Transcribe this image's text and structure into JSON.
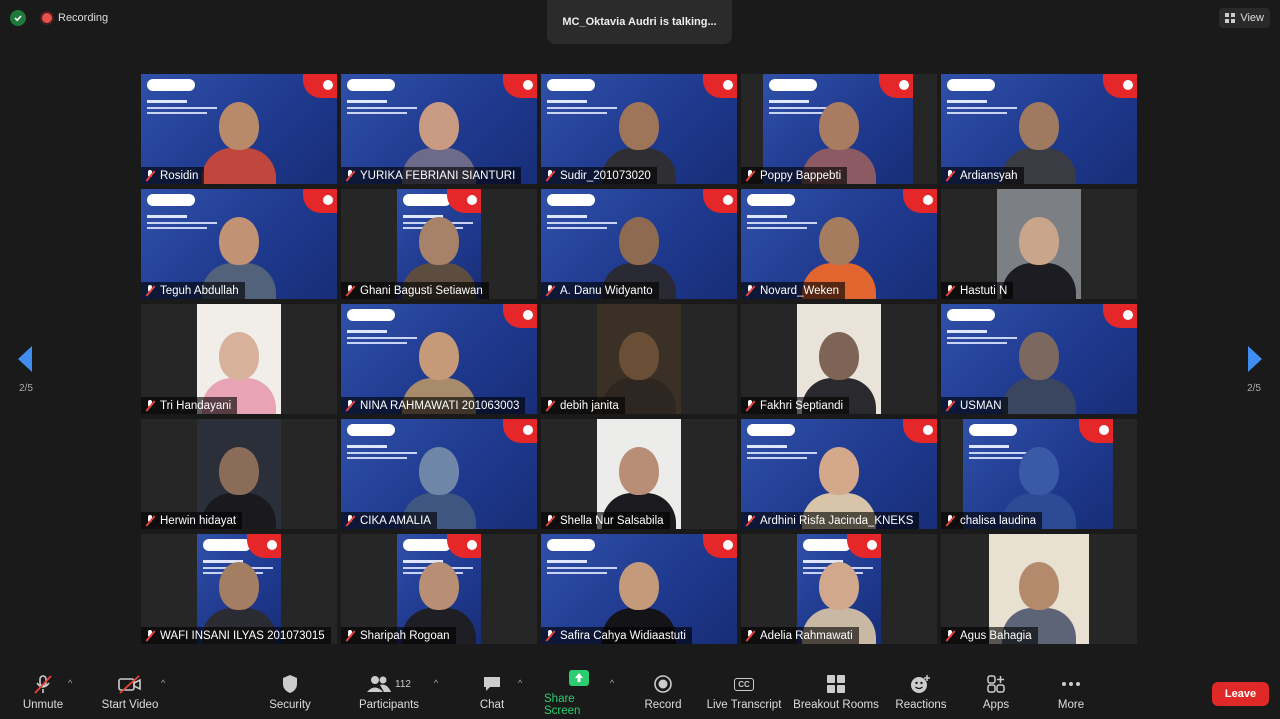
{
  "top": {
    "recording_label": "Recording",
    "talking_label": "MC_Oktavia Audri is talking...",
    "view_label": "View"
  },
  "pagination": {
    "left": "2/5",
    "right": "2/5"
  },
  "participants": [
    {
      "name": "Rosidin",
      "bg": "slide-full",
      "skin": "#b98a6a",
      "shirt": "#c0473d"
    },
    {
      "name": "YURIKA FEBRIANI SIANTURI",
      "bg": "slide-full",
      "skin": "#c99b82",
      "shirt": "#6d6a8a"
    },
    {
      "name": "Sudir_201073020",
      "bg": "slide-full",
      "skin": "#9e7558",
      "shirt": "#2f2f33"
    },
    {
      "name": "Poppy Bappebti",
      "bg": "slide-mid",
      "skin": "#a97c62",
      "shirt": "#8c5a62"
    },
    {
      "name": "Ardiansyah",
      "bg": "slide-full",
      "skin": "#a07a60",
      "shirt": "#3b3b44"
    },
    {
      "name": "Teguh Abdullah",
      "bg": "slide-full",
      "skin": "#c29274",
      "shirt": "#51627a"
    },
    {
      "name": "Ghani Bagusti Setiawan",
      "bg": "slide-narrow",
      "skin": "#a88268",
      "shirt": "#5d4c40"
    },
    {
      "name": "A. Danu Widyanto",
      "bg": "slide-full",
      "skin": "#8e6a50",
      "shirt": "#2a2a34"
    },
    {
      "name": "Novard_Weken",
      "bg": "slide-full",
      "skin": "#a57c5e",
      "shirt": "#e0652e"
    },
    {
      "name": "Hastuti N",
      "bg": "cam-narrow",
      "skin": "#c9a58b",
      "shirt": "#1c1c22",
      "cambg": "#7c7f84"
    },
    {
      "name": "Tri Handayani",
      "bg": "cam-narrow",
      "skin": "#d8b19a",
      "shirt": "#e8a3b4",
      "cambg": "#f1eee9"
    },
    {
      "name": "NINA RAHMAWATI 201063003",
      "bg": "slide-full",
      "skin": "#c69a78",
      "shirt": "#a78b6a"
    },
    {
      "name": "debih janita",
      "bg": "cam-narrow",
      "skin": "#6a4e36",
      "shirt": "#2e2620",
      "cambg": "#3a3026"
    },
    {
      "name": "Fakhri Septiandi",
      "bg": "cam-narrow",
      "skin": "#7e6454",
      "shirt": "#2a2a2e",
      "cambg": "#e9e3d9"
    },
    {
      "name": "USMAN",
      "bg": "slide-full",
      "skin": "#7d6860",
      "shirt": "#3a4660"
    },
    {
      "name": "Herwin hidayat",
      "bg": "cam-narrow",
      "skin": "#8a6c58",
      "shirt": "#1a1a1e",
      "cambg": "#2b2f3a"
    },
    {
      "name": "CIKA AMALIA",
      "bg": "slide-full",
      "skin": "#6f86a8",
      "shirt": "#3f5680"
    },
    {
      "name": "Shella Nur Salsabila",
      "bg": "cam-narrow",
      "skin": "#b98e76",
      "shirt": "#1b1b1f",
      "cambg": "#ececea"
    },
    {
      "name": "Ardhini Risfa Jacinda_KNEKS",
      "bg": "slide-full",
      "skin": "#d4a88a",
      "shirt": "#d8c4a8"
    },
    {
      "name": "chalisa laudina",
      "bg": "slide-mid",
      "skin": "#3a5aa8",
      "shirt": "#2d4a96"
    },
    {
      "name": "WAFI INSANI ILYAS 201073015",
      "bg": "slide-narrow",
      "skin": "#a47e62",
      "shirt": "#2b2b33"
    },
    {
      "name": "Sharipah Rogoan",
      "bg": "slide-narrow",
      "skin": "#b88e74",
      "shirt": "#1e1e24"
    },
    {
      "name": "Safira Cahya Widiaastuti",
      "bg": "slide-full",
      "skin": "#c59a7a",
      "shirt": "#141418"
    },
    {
      "name": "Adelia Rahmawati",
      "bg": "slide-narrow",
      "skin": "#d2a88c",
      "shirt": "#c8b8a4"
    },
    {
      "name": "Agus Bahagia",
      "bg": "cam-half",
      "skin": "#b48a6c",
      "shirt": "#5e6478",
      "cambg": "#e8e0d0"
    }
  ],
  "toolbar": {
    "unmute": "Unmute",
    "start_video": "Start Video",
    "security": "Security",
    "participants": "Participants",
    "participants_count": "112",
    "chat": "Chat",
    "share_screen": "Share Screen",
    "record": "Record",
    "live_transcript": "Live Transcript",
    "cc_badge": "CC",
    "breakout_rooms": "Breakout Rooms",
    "reactions": "Reactions",
    "apps": "Apps",
    "more": "More",
    "leave": "Leave"
  },
  "colors": {
    "accent_green": "#2ecc71",
    "leave_red": "#e02828",
    "arrow_blue": "#3f8ef0",
    "mic_off_red": "#e8433a"
  }
}
